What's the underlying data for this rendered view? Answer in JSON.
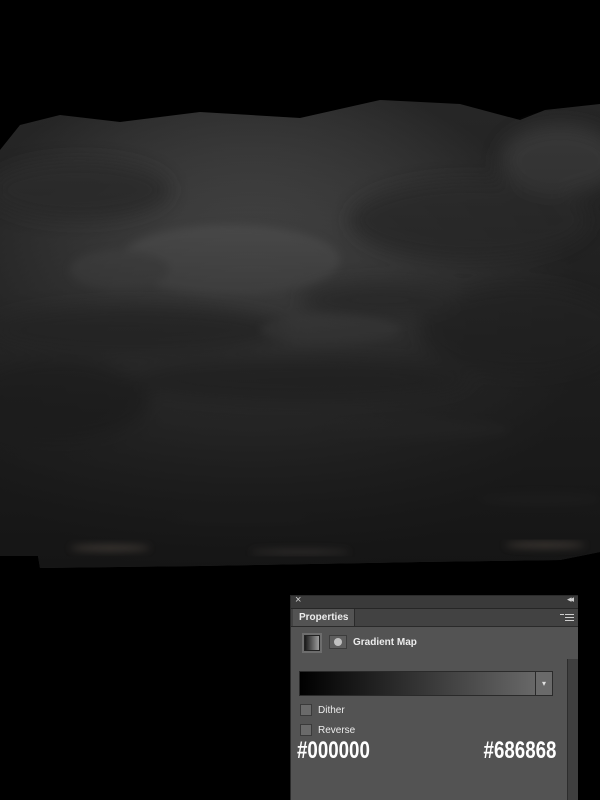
{
  "canvas": {
    "background": "#000000"
  },
  "panel": {
    "close_icon": "×",
    "collapse_icon": "◂◂",
    "tab_label": "Properties",
    "menu_icon": "panel-menu-icon",
    "adjustment_title": "Gradient Map",
    "gradient": {
      "start_color": "#000000",
      "end_color": "#686868"
    },
    "dropdown_icon": "▾",
    "dither": {
      "label": "Dither",
      "checked": false
    },
    "reverse": {
      "label": "Reverse",
      "checked": false
    },
    "panel_color": "#535353"
  },
  "overlay": {
    "start_hex": "#000000",
    "end_hex": "#686868"
  }
}
